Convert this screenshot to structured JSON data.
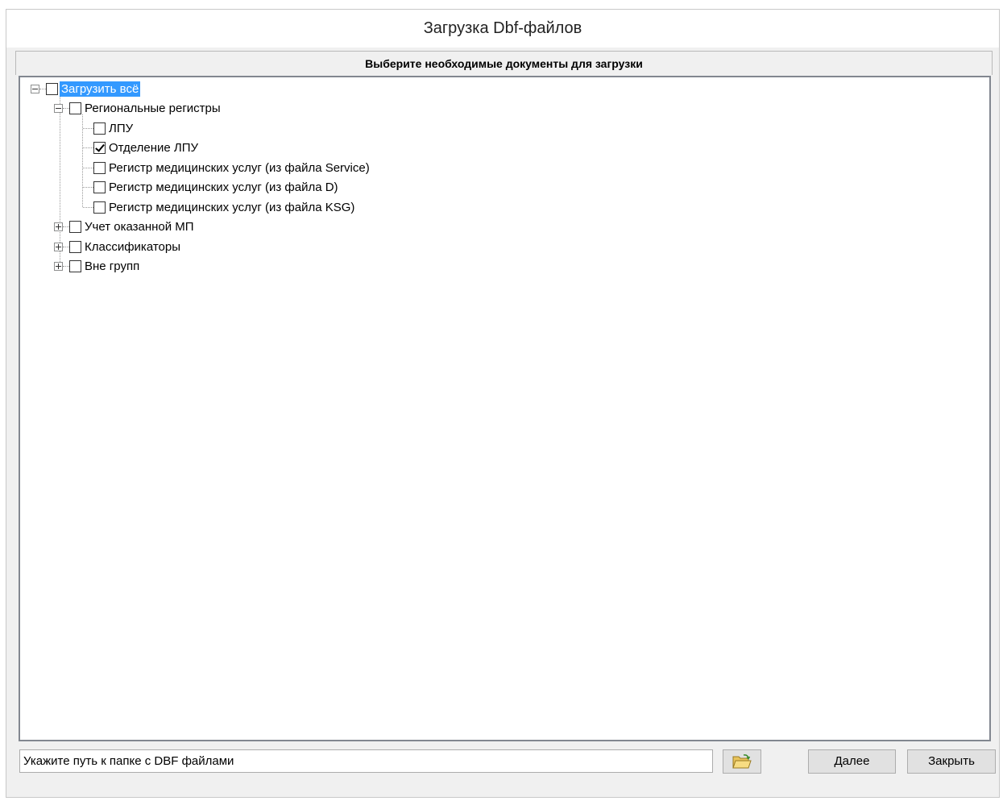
{
  "window": {
    "title": "Загрузка Dbf-файлов"
  },
  "panel": {
    "header": "Выберите необходимые документы для загрузки"
  },
  "tree": {
    "root": {
      "label": "Загрузить всё",
      "checked": false,
      "expanded": true,
      "selected": true
    },
    "groups": [
      {
        "label": "Региональные регистры",
        "checked": false,
        "expanded": true,
        "children": [
          {
            "label": "ЛПУ",
            "checked": false
          },
          {
            "label": "Отделение ЛПУ",
            "checked": true
          },
          {
            "label": "Регистр медицинских услуг (из файла Service)",
            "checked": false
          },
          {
            "label": "Регистр медицинских услуг (из файла D)",
            "checked": false
          },
          {
            "label": "Регистр медицинских услуг (из файла KSG)",
            "checked": false
          }
        ]
      },
      {
        "label": "Учет оказанной МП",
        "checked": false,
        "expanded": false
      },
      {
        "label": "Классификаторы",
        "checked": false,
        "expanded": false
      },
      {
        "label": "Вне групп",
        "checked": false,
        "expanded": false
      }
    ]
  },
  "path": {
    "placeholder": "Укажите путь к папке с DBF файлами",
    "value": ""
  },
  "buttons": {
    "browse_icon": "folder-open-icon",
    "next": "Далее",
    "close": "Закрыть"
  },
  "colors": {
    "selection": "#3399ff",
    "window_bg": "#f0f0f0"
  }
}
